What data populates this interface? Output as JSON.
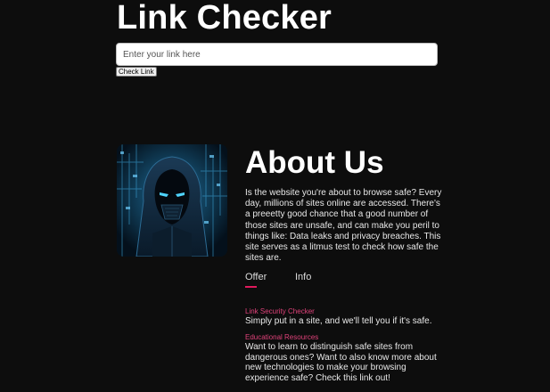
{
  "header": {
    "title": "Link Checker"
  },
  "search": {
    "placeholder": "Enter your link here",
    "value": "",
    "button_label": "Check Link"
  },
  "about": {
    "title": "About Us",
    "description": "Is the website you're about to browse safe? Every day, millions of sites online are accessed. There's a preeetty good chance that a good number of those sites are unsafe, and can make you peril to things like: Data leaks and privacy breaches. This site serves as a litmus test to check how safe the sites are.",
    "hero_icon": "hooded-hacker-icon"
  },
  "tabs": [
    {
      "label": "Offer",
      "active": true
    },
    {
      "label": "Info",
      "active": false
    }
  ],
  "offers": [
    {
      "heading": "Link Security Checker",
      "text": "Simply put in a site, and we'll tell you if it's safe."
    },
    {
      "heading": "Educational Resources",
      "text": "Want to learn to distinguish safe sites from dangerous ones? Want to also know more about new technologies to make your browsing experience safe? Check this link out!"
    }
  ],
  "colors": {
    "background": "#0d0d0d",
    "accent": "#e0195c",
    "accent_text": "#e0427a"
  }
}
